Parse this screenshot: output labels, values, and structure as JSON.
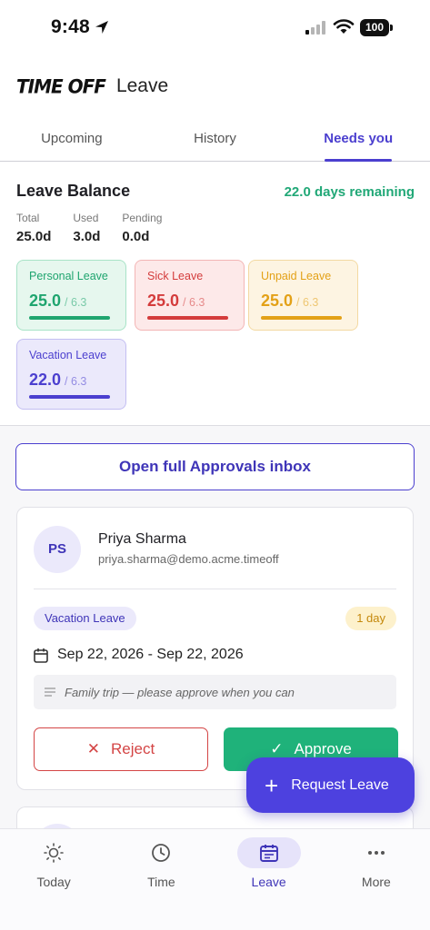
{
  "status_bar": {
    "time": "9:48",
    "battery": "100"
  },
  "header": {
    "logo": "TIME OFF",
    "title": "Leave"
  },
  "tabs": [
    {
      "label": "Upcoming",
      "active": false
    },
    {
      "label": "History",
      "active": false
    },
    {
      "label": "Needs you",
      "active": true
    }
  ],
  "balance": {
    "title": "Leave Balance",
    "remaining": "22.0 days remaining",
    "stats": [
      {
        "label": "Total",
        "value": "25.0d"
      },
      {
        "label": "Used",
        "value": "3.0d"
      },
      {
        "label": "Pending",
        "value": "0.0d"
      }
    ],
    "cards": [
      {
        "label": "Personal Leave",
        "big": "25.0",
        "small": "/ 6.3",
        "color": "#1fa56f",
        "bg": "#e6f7ee",
        "border": "#a8e3c7",
        "level": 1.0
      },
      {
        "label": "Sick Leave",
        "big": "25.0",
        "small": "/ 6.3",
        "color": "#d43c3c",
        "bg": "#fde9e9",
        "border": "#f3b5b5",
        "level": 1.0
      },
      {
        "label": "Unpaid Leave",
        "big": "25.0",
        "small": "/ 6.3",
        "color": "#e3a117",
        "bg": "#fdf4e2",
        "border": "#f3d9a2",
        "level": 1.0
      },
      {
        "label": "Vacation Leave",
        "big": "22.0",
        "small": "/ 6.3",
        "color": "#4b3fcf",
        "bg": "#ebe9fb",
        "border": "#c4bff2",
        "level": 1.0
      }
    ]
  },
  "approvals_button": "Open full Approvals inbox",
  "request": {
    "initials": "PS",
    "name": "Priya Sharma",
    "email": "priya.sharma@demo.acme.timeoff",
    "type": "Vacation Leave",
    "days": "1 day",
    "dates": "Sep 22, 2026 - Sep 22, 2026",
    "note": "Family trip — please approve when you can",
    "reject_label": "Reject",
    "approve_label": "Approve"
  },
  "fab": {
    "label": "Request Leave"
  },
  "nav": [
    {
      "label": "Today",
      "icon": "sun-icon",
      "active": false
    },
    {
      "label": "Time",
      "icon": "clock-icon",
      "active": false
    },
    {
      "label": "Leave",
      "icon": "calendar-icon",
      "active": true
    },
    {
      "label": "More",
      "icon": "more-icon",
      "active": false
    }
  ]
}
